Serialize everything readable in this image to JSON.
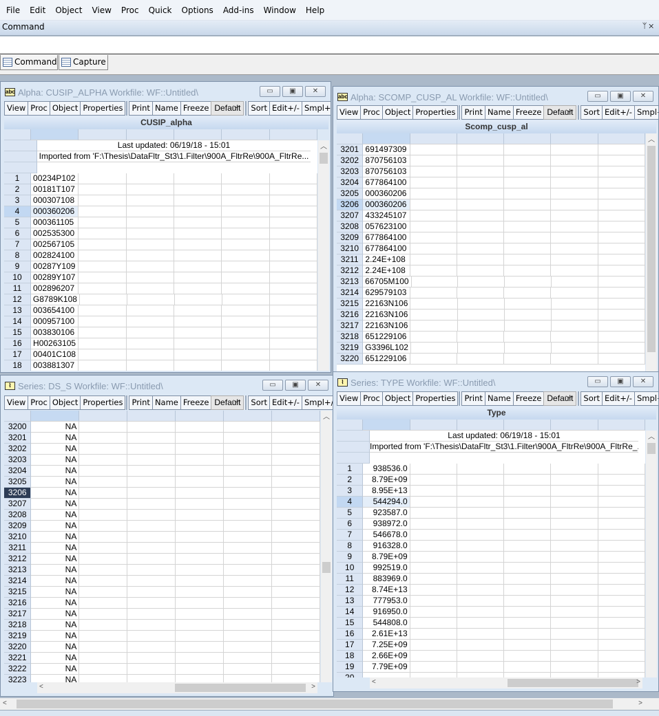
{
  "menu": [
    "File",
    "Edit",
    "Object",
    "View",
    "Proc",
    "Quick",
    "Options",
    "Add-ins",
    "Window",
    "Help"
  ],
  "command": {
    "label": "Command",
    "pin": "ᛘ ✕",
    "tabs": [
      "Command",
      "Capture"
    ]
  },
  "toolbar": {
    "group1": [
      "View",
      "Proc",
      "Object",
      "Properties"
    ],
    "group2": [
      "Print",
      "Name",
      "Freeze"
    ],
    "dropdown": "Default",
    "group3": [
      "Sort",
      "Edit+/-",
      "Smpl+/-"
    ]
  },
  "windows": [
    {
      "id": "cusip",
      "icon": "abc",
      "title": "Alpha: CUSIP_ALPHA   Workfile: WF::Untitled\\",
      "header": "CUSIP_alpha",
      "meta": [
        "Last updated: 06/19/18 - 15:01",
        "Imported from 'F:\\Thesis\\DataFltr_St3\\1.Filter\\900A_FltrRe\\900A_FltrRe..."
      ],
      "align": "left",
      "selected": "4",
      "rows": [
        [
          "1",
          "00234P102"
        ],
        [
          "2",
          "00181T107"
        ],
        [
          "3",
          "000307108"
        ],
        [
          "4",
          "000360206"
        ],
        [
          "5",
          "000361105"
        ],
        [
          "6",
          "002535300"
        ],
        [
          "7",
          "002567105"
        ],
        [
          "8",
          "002824100"
        ],
        [
          "9",
          "00287Y109"
        ],
        [
          "10",
          "00289Y107"
        ],
        [
          "11",
          "002896207"
        ],
        [
          "12",
          "G8789K108"
        ],
        [
          "13",
          "003654100"
        ],
        [
          "14",
          "000957100"
        ],
        [
          "15",
          "003830106"
        ],
        [
          "16",
          "H00263105"
        ],
        [
          "17",
          "00401C108"
        ],
        [
          "18",
          "003881307"
        ]
      ]
    },
    {
      "id": "scomp",
      "icon": "abc",
      "title": "Alpha: SCOMP_CUSP_AL   Workfile: WF::Untitled\\",
      "header": "Scomp_cusp_al",
      "meta": [],
      "align": "left",
      "selected": "3206",
      "rows": [
        [
          "3201",
          "691497309"
        ],
        [
          "3202",
          "870756103"
        ],
        [
          "3203",
          "870756103"
        ],
        [
          "3204",
          "677864100"
        ],
        [
          "3205",
          "000360206"
        ],
        [
          "3206",
          "000360206"
        ],
        [
          "3207",
          "433245107"
        ],
        [
          "3208",
          "057623100"
        ],
        [
          "3209",
          "677864100"
        ],
        [
          "3210",
          "677864100"
        ],
        [
          "3211",
          "2.24E+108"
        ],
        [
          "3212",
          "2.24E+108"
        ],
        [
          "3213",
          "66705M100"
        ],
        [
          "3214",
          "629579103"
        ],
        [
          "3215",
          "22163N106"
        ],
        [
          "3216",
          "22163N106"
        ],
        [
          "3217",
          "22163N106"
        ],
        [
          "3218",
          "651229106"
        ],
        [
          "3219",
          "G3396L102"
        ],
        [
          "3220",
          "651229106"
        ]
      ]
    },
    {
      "id": "ds_s",
      "icon": "series",
      "title": "Series: DS_S   Workfile: WF::Untitled\\",
      "header": "",
      "meta": [],
      "align": "right",
      "selected": "3206",
      "selected_style": "dark",
      "rows": [
        [
          "3200",
          "NA"
        ],
        [
          "3201",
          "NA"
        ],
        [
          "3202",
          "NA"
        ],
        [
          "3203",
          "NA"
        ],
        [
          "3204",
          "NA"
        ],
        [
          "3205",
          "NA"
        ],
        [
          "3206",
          "NA"
        ],
        [
          "3207",
          "NA"
        ],
        [
          "3208",
          "NA"
        ],
        [
          "3209",
          "NA"
        ],
        [
          "3210",
          "NA"
        ],
        [
          "3211",
          "NA"
        ],
        [
          "3212",
          "NA"
        ],
        [
          "3213",
          "NA"
        ],
        [
          "3214",
          "NA"
        ],
        [
          "3215",
          "NA"
        ],
        [
          "3216",
          "NA"
        ],
        [
          "3217",
          "NA"
        ],
        [
          "3218",
          "NA"
        ],
        [
          "3219",
          "NA"
        ],
        [
          "3220",
          "NA"
        ],
        [
          "3221",
          "NA"
        ],
        [
          "3222",
          "NA"
        ],
        [
          "3223",
          "NA"
        ],
        [
          "3224",
          ""
        ]
      ]
    },
    {
      "id": "type",
      "icon": "series",
      "title": "Series: TYPE   Workfile: WF::Untitled\\",
      "header": "Type",
      "meta": [
        "Last updated: 06/19/18 - 15:01",
        "Imported from 'F:\\Thesis\\DataFltr_St3\\1.Filter\\900A_FltrRe\\900A_FltrRe_..."
      ],
      "align": "right",
      "selected": "4",
      "rows": [
        [
          "1",
          "938536.0"
        ],
        [
          "2",
          "8.79E+09"
        ],
        [
          "3",
          "8.95E+13"
        ],
        [
          "4",
          "544294.0"
        ],
        [
          "5",
          "923587.0"
        ],
        [
          "6",
          "938972.0"
        ],
        [
          "7",
          "546678.0"
        ],
        [
          "8",
          "916328.0"
        ],
        [
          "9",
          "8.79E+09"
        ],
        [
          "10",
          "992519.0"
        ],
        [
          "11",
          "883969.0"
        ],
        [
          "12",
          "8.74E+13"
        ],
        [
          "13",
          "777953.0"
        ],
        [
          "14",
          "916950.0"
        ],
        [
          "15",
          "544808.0"
        ],
        [
          "16",
          "2.61E+13"
        ],
        [
          "17",
          "7.25E+09"
        ],
        [
          "18",
          "2.66E+09"
        ],
        [
          "19",
          "7.79E+09"
        ],
        [
          "20",
          ""
        ]
      ]
    }
  ]
}
